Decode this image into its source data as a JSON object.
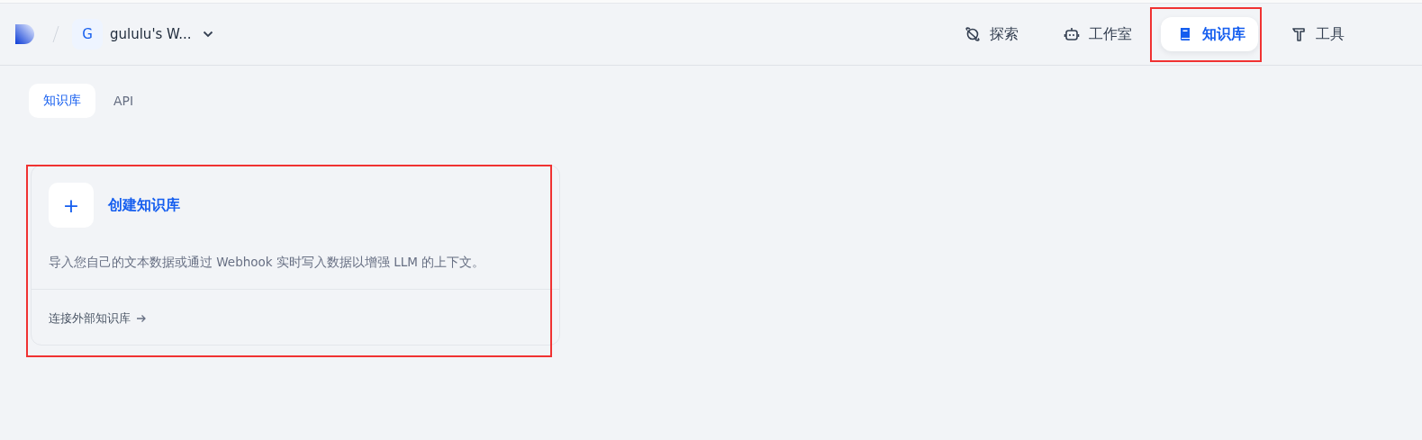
{
  "header": {
    "workspace": {
      "initial": "G",
      "name": "gululu's W..."
    },
    "nav": [
      {
        "label": "探索",
        "selected": false,
        "highlighted": false
      },
      {
        "label": "工作室",
        "selected": false,
        "highlighted": false
      },
      {
        "label": "知识库",
        "selected": true,
        "highlighted": true
      },
      {
        "label": "工具",
        "selected": false,
        "highlighted": false
      }
    ]
  },
  "tabs": [
    {
      "label": "知识库",
      "selected": true
    },
    {
      "label": "API",
      "selected": false
    }
  ],
  "card": {
    "highlighted": true,
    "icon": "+",
    "title": "创建知识库",
    "description": "导入您自己的文本数据或通过 Webhook 实时写入数据以增强 LLM 的上下文。",
    "link": "连接外部知识库"
  }
}
